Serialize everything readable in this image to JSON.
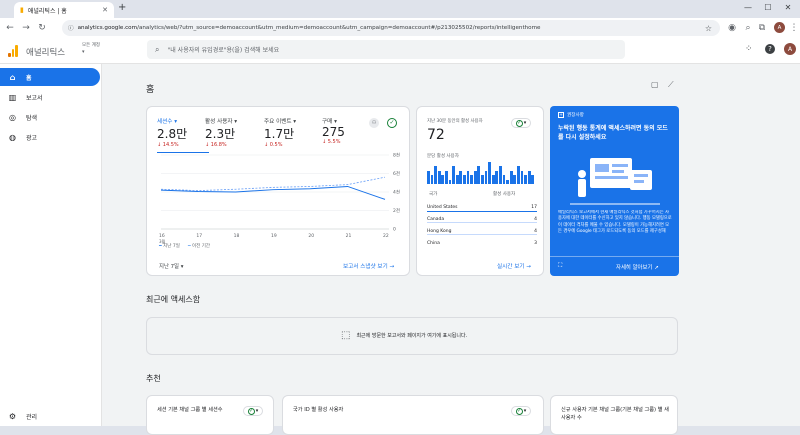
{
  "browser": {
    "tab_title": "애널리틱스 | 홈",
    "new_tab": "+",
    "url_host": "analytics.google.com",
    "url_path": "/analytics/web/?utm_source=demoaccount&utm_medium=demoaccount&utm_campaign=demoaccount#/p213025502/reports/intelligenthome",
    "profile_initial": "A",
    "window_controls": [
      "—",
      "☐",
      "✕"
    ]
  },
  "appbar": {
    "brand": "애널리틱스",
    "account_label": "모든 계정",
    "search_placeholder": "\"내 사용자의 유입경로\"용(을) 검색해 보세요",
    "avatar_initial": "A"
  },
  "sidebar": {
    "items": [
      {
        "label": "홈",
        "icon": "home-icon",
        "active": true
      },
      {
        "label": "보고서",
        "icon": "reports-icon",
        "active": false
      },
      {
        "label": "탐색",
        "icon": "explore-icon",
        "active": false
      },
      {
        "label": "광고",
        "icon": "advertising-icon",
        "active": false
      }
    ],
    "admin_label": "관리"
  },
  "main": {
    "title": "홈",
    "overview": {
      "metrics": [
        {
          "label": "세션수",
          "value": "2.8만",
          "change": "↓ 14.5%"
        },
        {
          "label": "활성 사용자",
          "value": "2.3만",
          "change": "↓ 16.8%"
        },
        {
          "label": "주요 이벤트",
          "value": "1.7만",
          "change": "↓ 0.5%"
        },
        {
          "label": "구매",
          "value": "275",
          "change": "↓ 5.5%"
        }
      ],
      "legend_current": "지난 7일",
      "legend_previous": "이전 기간",
      "date_range": "지난 7일",
      "link": "보고서 스냅샷 보기",
      "chart_data": {
        "type": "line",
        "x": [
          "16",
          "17",
          "18",
          "19",
          "20",
          "21",
          "22"
        ],
        "x_month": "3월",
        "yticks": [
          "0",
          "2천",
          "4천",
          "6천",
          "8천"
        ],
        "ylim": [
          0,
          8000
        ],
        "series": [
          {
            "name": "지난 7일",
            "values": [
              4200,
              4050,
              4000,
              4250,
              4350,
              4600,
              3200
            ]
          },
          {
            "name": "이전 기간",
            "values": [
              4300,
              4150,
              4300,
              4500,
              4600,
              4800,
              5600
            ]
          }
        ]
      }
    },
    "realtime": {
      "title": "지난 30분 동안의 활성 사용자",
      "value": "72",
      "per_min_label": "분당 활성 사용자",
      "table_header": [
        "국가",
        "활성 사용자"
      ],
      "rows": [
        {
          "country": "United States",
          "users": "17"
        },
        {
          "country": "Canada",
          "users": "4"
        },
        {
          "country": "Hong Kong",
          "users": "4"
        },
        {
          "country": "China",
          "users": "3"
        }
      ],
      "link": "실시간 보기",
      "chart_data": {
        "type": "bar",
        "values": [
          3,
          2,
          4,
          3,
          2,
          3,
          1,
          4,
          2,
          3,
          2,
          3,
          2,
          3,
          4,
          2,
          3,
          5,
          2,
          3,
          4,
          2,
          1,
          3,
          2,
          4,
          3,
          2,
          3,
          2
        ]
      }
    },
    "promo": {
      "badge": "권장사항",
      "title": "누락된 행동 통계에 액세스하려면 동의 모드를 다시 설정하세요",
      "body": "애널리틱스 보고서에서 현재 애널리틱스 것처럼 가꾸어지는 사용자에 대한 데이터를 수신하고 있지 않습니다. 행동 모델링으로 이 데이터 격차를 메울 수 있습니다. 모델링이 가능해지려면 모든 경우에 Google 태그가 로드되도록 동의 모드를 제구성해",
      "link": "자세히 알아보기"
    },
    "recent": {
      "title": "최근에 액세스함",
      "empty_text": "최근에 방문한 보고서와 페이지가 여기에 표시됩니다."
    },
    "recommend": {
      "title": "추천",
      "cards": [
        "세션 기본 채널 그룹 별 세션수",
        "국가 ID 별 활성 사용자",
        "신규 사용자 기본 채널 그룹(기본 채널 그룹) 별 새 사용자 수"
      ]
    }
  }
}
